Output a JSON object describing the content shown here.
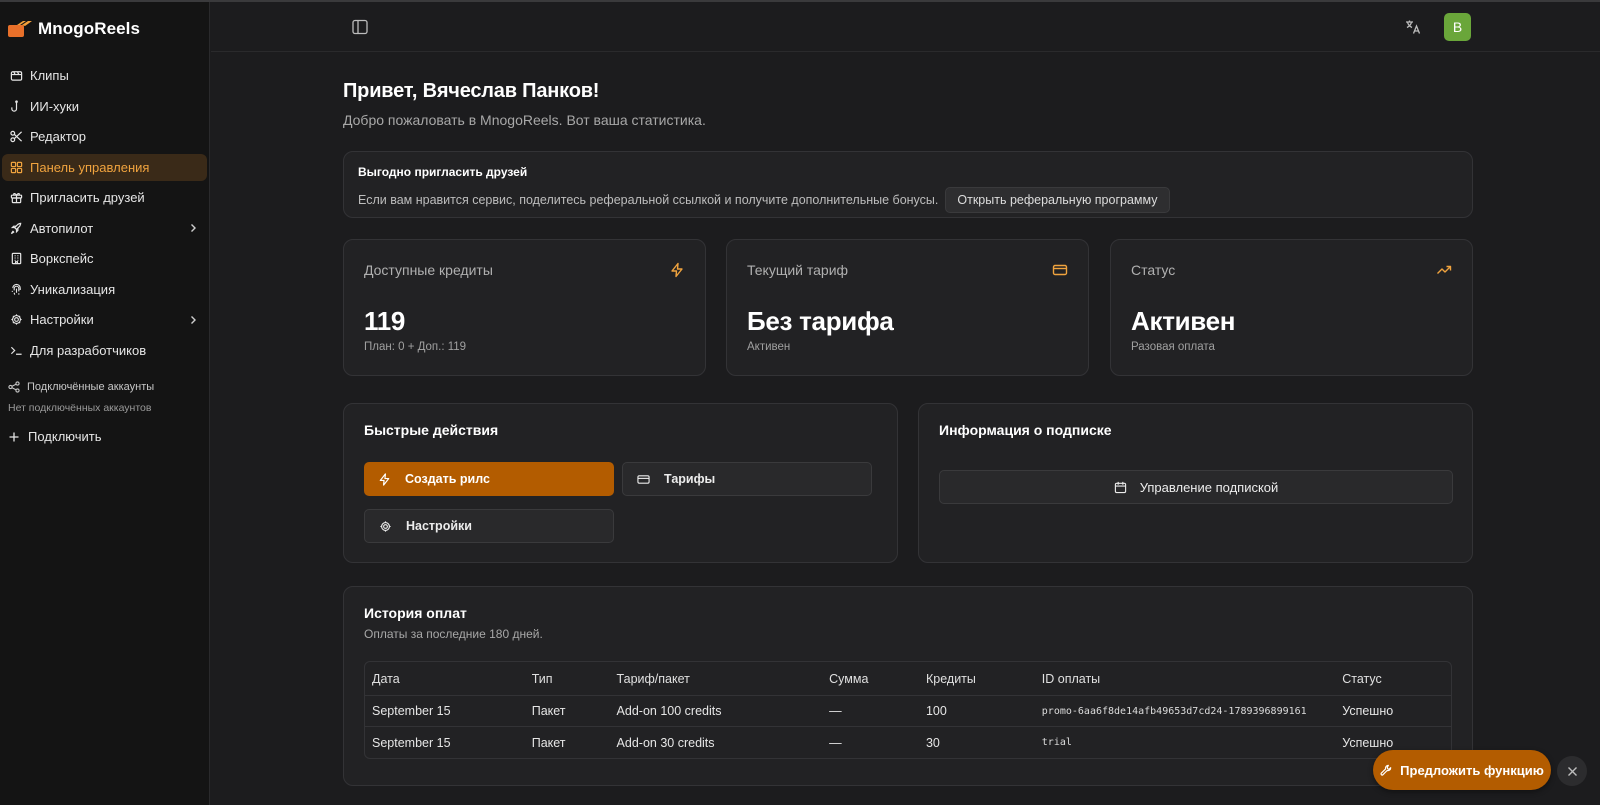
{
  "app": {
    "name": "MnogoReels"
  },
  "colors": {
    "accent": "#f0a33e",
    "primary_button": "#b35c00",
    "avatar": "#6aa63a"
  },
  "sidebar": {
    "items": [
      {
        "label": "Клипы",
        "icon": "clips-icon"
      },
      {
        "label": "ИИ-хуки",
        "icon": "hook-icon"
      },
      {
        "label": "Редактор",
        "icon": "scissors-icon"
      },
      {
        "label": "Панель управления",
        "icon": "dashboard-icon",
        "active": true
      },
      {
        "label": "Пригласить друзей",
        "icon": "gift-icon"
      },
      {
        "label": "Автопилот",
        "icon": "rocket-icon",
        "expandable": true
      },
      {
        "label": "Воркспейс",
        "icon": "building-icon"
      },
      {
        "label": "Уникализация",
        "icon": "fingerprint-icon"
      },
      {
        "label": "Настройки",
        "icon": "gear-icon",
        "expandable": true
      },
      {
        "label": "Для разработчиков",
        "icon": "terminal-icon"
      }
    ],
    "connected_title": "Подключённые аккаунты",
    "connected_empty": "Нет подключённых аккаунтов",
    "connect_label": "Подключить"
  },
  "header": {
    "avatar_letter": "В"
  },
  "greeting": {
    "title": "Привет, Вячеслав Панков!",
    "subtitle": "Добро пожаловать в MnogoReels. Вот ваша статистика."
  },
  "referral": {
    "title": "Выгодно пригласить друзей",
    "text": "Если вам нравится сервис, поделитесь реферальной ссылкой и получите дополнительные бонусы.",
    "button": "Открыть реферальную программу"
  },
  "stats": [
    {
      "label": "Доступные кредиты",
      "value": "119",
      "note": "План: 0 + Доп.: 119",
      "icon": "lightning-icon"
    },
    {
      "label": "Текущий тариф",
      "value": "Без тарифа",
      "note": "Активен",
      "icon": "credit-card-icon"
    },
    {
      "label": "Статус",
      "value": "Активен",
      "note": "Разовая оплата",
      "icon": "trending-up-icon"
    }
  ],
  "quick_actions": {
    "title": "Быстрые действия",
    "create": "Создать рилс",
    "tariffs": "Тарифы",
    "settings": "Настройки"
  },
  "subscription": {
    "title": "Информация о подписке",
    "manage": "Управление подпиской"
  },
  "payments": {
    "title": "История оплат",
    "subtitle": "Оплаты за последние 180 дней.",
    "columns": [
      "Дата",
      "Тип",
      "Тариф/пакет",
      "Сумма",
      "Кредиты",
      "ID оплаты",
      "Статус"
    ],
    "rows": [
      [
        "September 15",
        "Пакет",
        "Add-on 100 credits",
        "—",
        "100",
        "promo-6aa6f8de14afb49653d7cd24-1789396899161",
        "Успешно"
      ],
      [
        "September 15",
        "Пакет",
        "Add-on 30 credits",
        "—",
        "30",
        "trial",
        "Успешно"
      ]
    ]
  },
  "floating": {
    "suggest": "Предложить функцию"
  }
}
